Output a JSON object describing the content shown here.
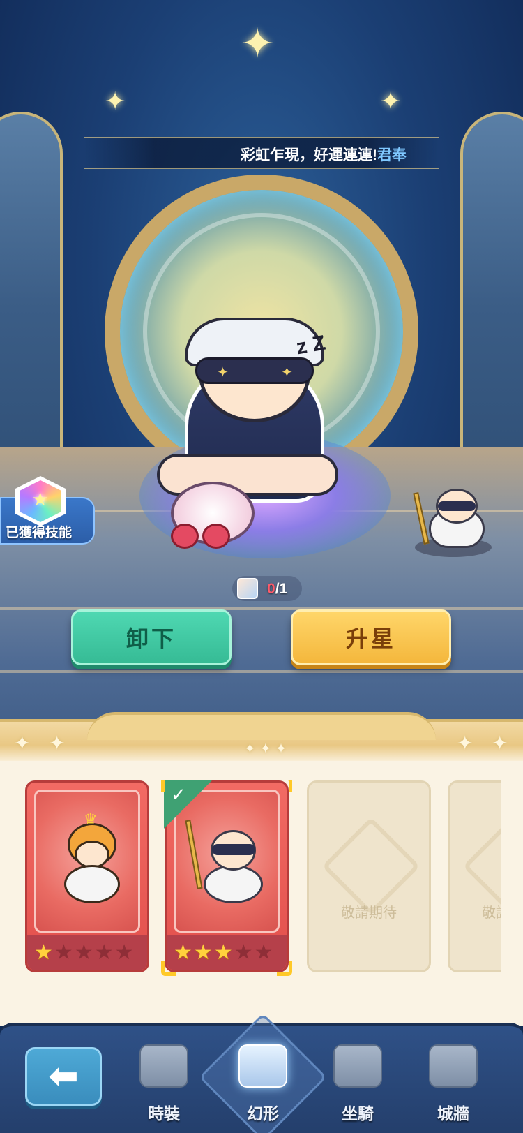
{
  "banner": {
    "text": "彩虹乍現，好運連連!",
    "highlight": "君奉"
  },
  "skill_badge": {
    "label": "已獲得技能"
  },
  "fragment": {
    "have": "0",
    "need": "/1"
  },
  "actions": {
    "unequip_label": "卸下",
    "upgrade_label": "升星"
  },
  "cards": [
    {
      "state": "owned",
      "stars": 1,
      "max_stars": 5,
      "selected": false
    },
    {
      "state": "owned",
      "stars": 3,
      "max_stars": 5,
      "selected": true
    },
    {
      "state": "locked",
      "label": "敬請期待"
    },
    {
      "state": "locked",
      "label": "敬請期待"
    }
  ],
  "nav": {
    "back_icon": "back-arrow-icon",
    "tabs": [
      {
        "label": "時裝",
        "icon": "outfit-icon",
        "active": false
      },
      {
        "label": "幻形",
        "icon": "transform-icon",
        "active": true
      },
      {
        "label": "坐騎",
        "icon": "mount-icon",
        "active": false
      },
      {
        "label": "城牆",
        "icon": "castle-wall-icon",
        "active": false
      }
    ]
  },
  "colors": {
    "unequip": "#3fc9a2",
    "upgrade": "#f8c44e",
    "nav_bg": "#2f5187",
    "panel_bg": "#faf3e4"
  }
}
